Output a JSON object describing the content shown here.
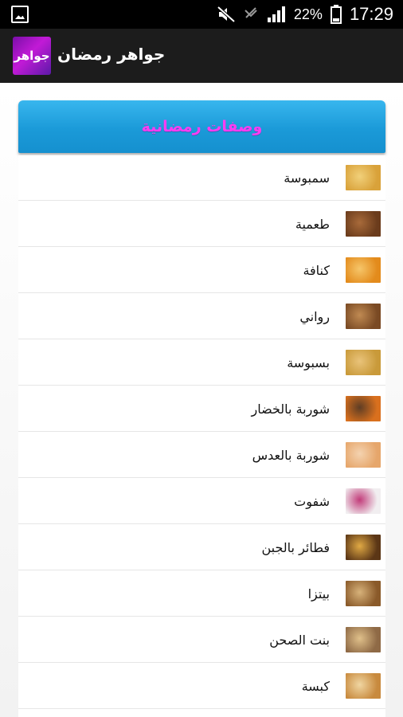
{
  "status_bar": {
    "battery": "22%",
    "time": "17:29",
    "icons": [
      "image-icon",
      "mute-icon",
      "no-signal-icon",
      "signal-icon",
      "battery-icon"
    ]
  },
  "action_bar": {
    "app_icon_text": "جواهر",
    "title": "جواهر رمضان"
  },
  "section": {
    "title": "وصفات رمضانية",
    "accent": "#1b9ad8",
    "title_color": "#ff3cf2"
  },
  "items": [
    {
      "label": "سمبوسة",
      "thumb": [
        "#d9a23a",
        "#f1d07a"
      ]
    },
    {
      "label": "طعمية",
      "thumb": [
        "#6b3c1c",
        "#a86a3a"
      ]
    },
    {
      "label": "كنافة",
      "thumb": [
        "#e38b1c",
        "#f6c66a"
      ]
    },
    {
      "label": "رواني",
      "thumb": [
        "#7a4a24",
        "#c08a52"
      ]
    },
    {
      "label": "بسبوسة",
      "thumb": [
        "#c99a3a",
        "#e9c37a"
      ]
    },
    {
      "label": "شوربة بالخضار",
      "thumb": [
        "#d9701e",
        "#5e3d24"
      ]
    },
    {
      "label": "شوربة بالعدس",
      "thumb": [
        "#e6a66b",
        "#f4d3b0"
      ]
    },
    {
      "label": "شفوت",
      "thumb": [
        "#f1eef0",
        "#c23c7a"
      ]
    },
    {
      "label": "فطائر بالجبن",
      "thumb": [
        "#5b3616",
        "#e0a944"
      ]
    },
    {
      "label": "بيتزا",
      "thumb": [
        "#8a5a2a",
        "#d7b27a"
      ]
    },
    {
      "label": "بنت الصحن",
      "thumb": [
        "#8f6a46",
        "#e0c08a"
      ]
    },
    {
      "label": "كبسة",
      "thumb": [
        "#c88a3e",
        "#f0d6a2"
      ]
    }
  ]
}
